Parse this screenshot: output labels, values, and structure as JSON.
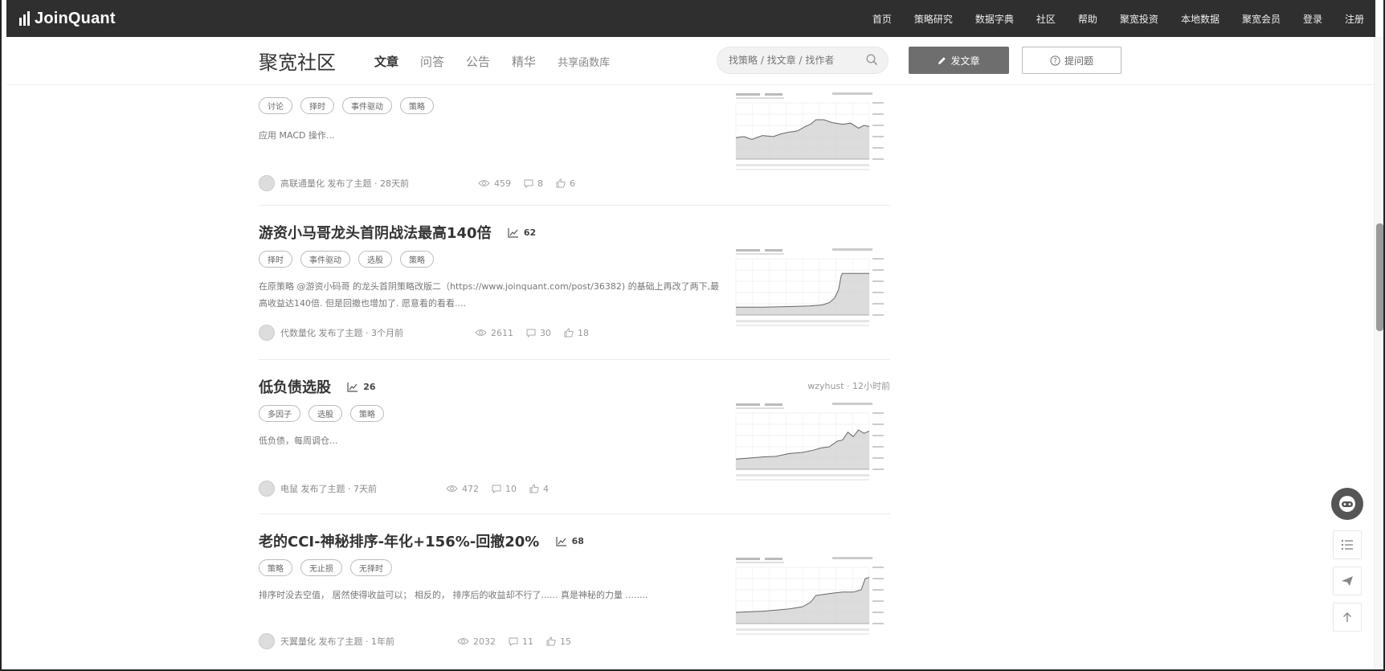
{
  "topnav": {
    "logo_text": "JoinQuant",
    "links": [
      "首页",
      "策略研究",
      "数据字典",
      "社区",
      "帮助",
      "聚宽投资",
      "本地数据",
      "聚宽会员",
      "登录",
      "注册"
    ]
  },
  "subhead": {
    "brand": "聚宽社区",
    "tabs": [
      "文章",
      "问答",
      "公告",
      "精华",
      "共享函数库"
    ],
    "active_tab": "文章",
    "search_placeholder": "找策略 / 找文章 / 找作者",
    "post_button": "发文章",
    "ask_button": "提问题"
  },
  "posts": [
    {
      "title": "",
      "trend": "",
      "tags": [
        "讨论",
        "择时",
        "事件驱动",
        "策略"
      ],
      "excerpt": "应用 MACD 操作...",
      "author_line": "高联通量化 发布了主题 · 28天前",
      "views": "459",
      "comments": "8",
      "likes": "6",
      "side": ""
    },
    {
      "title": "游资小马哥龙头首阴战法最高140倍",
      "trend": "62",
      "tags": [
        "择时",
        "事件驱动",
        "选股",
        "策略"
      ],
      "excerpt": "在原策略 @游资小码哥 的龙头首阴策略改版二（https://www.joinquant.com/post/36382) 的基础上再改了两下,最高收益达140倍. 但是回撤也增加了. 愿意看的看看....",
      "author_line": "代数量化 发布了主题 · 3个月前",
      "views": "2611",
      "comments": "30",
      "likes": "18",
      "side": ""
    },
    {
      "title": "低负债选股",
      "trend": "26",
      "tags": [
        "多因子",
        "选股",
        "策略"
      ],
      "excerpt": "低负债，每周调仓...",
      "author_line": "电鼠 发布了主题 · 7天前",
      "views": "472",
      "comments": "10",
      "likes": "4",
      "side": "wzyhust · 12小时前"
    },
    {
      "title": "老的CCI-神秘排序-年化+156%-回撤20%",
      "trend": "68",
      "tags": [
        "策略",
        "无止损",
        "无择时"
      ],
      "excerpt": "排序时没去空值， 居然使得收益可以； 相反的， 排序后的收益却不行了...... 真是神秘的力量 ........",
      "author_line": "天翼量化 发布了主题 · 1年前",
      "views": "2032",
      "comments": "11",
      "likes": "15",
      "side": ""
    }
  ],
  "chart_kinds": [
    "step",
    "spike",
    "rise",
    "plateau"
  ],
  "colors": {
    "nav_bg": "#2f2f2f",
    "post_button_bg": "#6e6e6e",
    "chart_fill": "#d0d0d0"
  }
}
